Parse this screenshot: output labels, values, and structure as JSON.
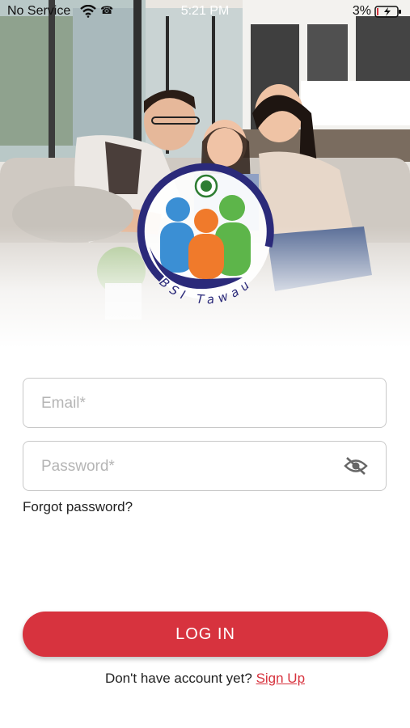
{
  "status_bar": {
    "carrier": "No Service",
    "time": "5:21 PM",
    "battery": "3%"
  },
  "brand": {
    "logo_text": "BSI Tawau",
    "colors": {
      "navy": "#2b2a7a",
      "blue": "#3b8fd4",
      "orange": "#f07a2b",
      "green": "#5db54a"
    }
  },
  "form": {
    "email_placeholder": "Email*",
    "password_placeholder": "Password*",
    "toggle_icon": "eye-off-icon",
    "forgot_label": "Forgot password?",
    "login_label": "LOG IN"
  },
  "signup": {
    "prompt": "Don't have account yet?",
    "link_label": "Sign Up"
  },
  "theme": {
    "accent": "#d7333e"
  }
}
